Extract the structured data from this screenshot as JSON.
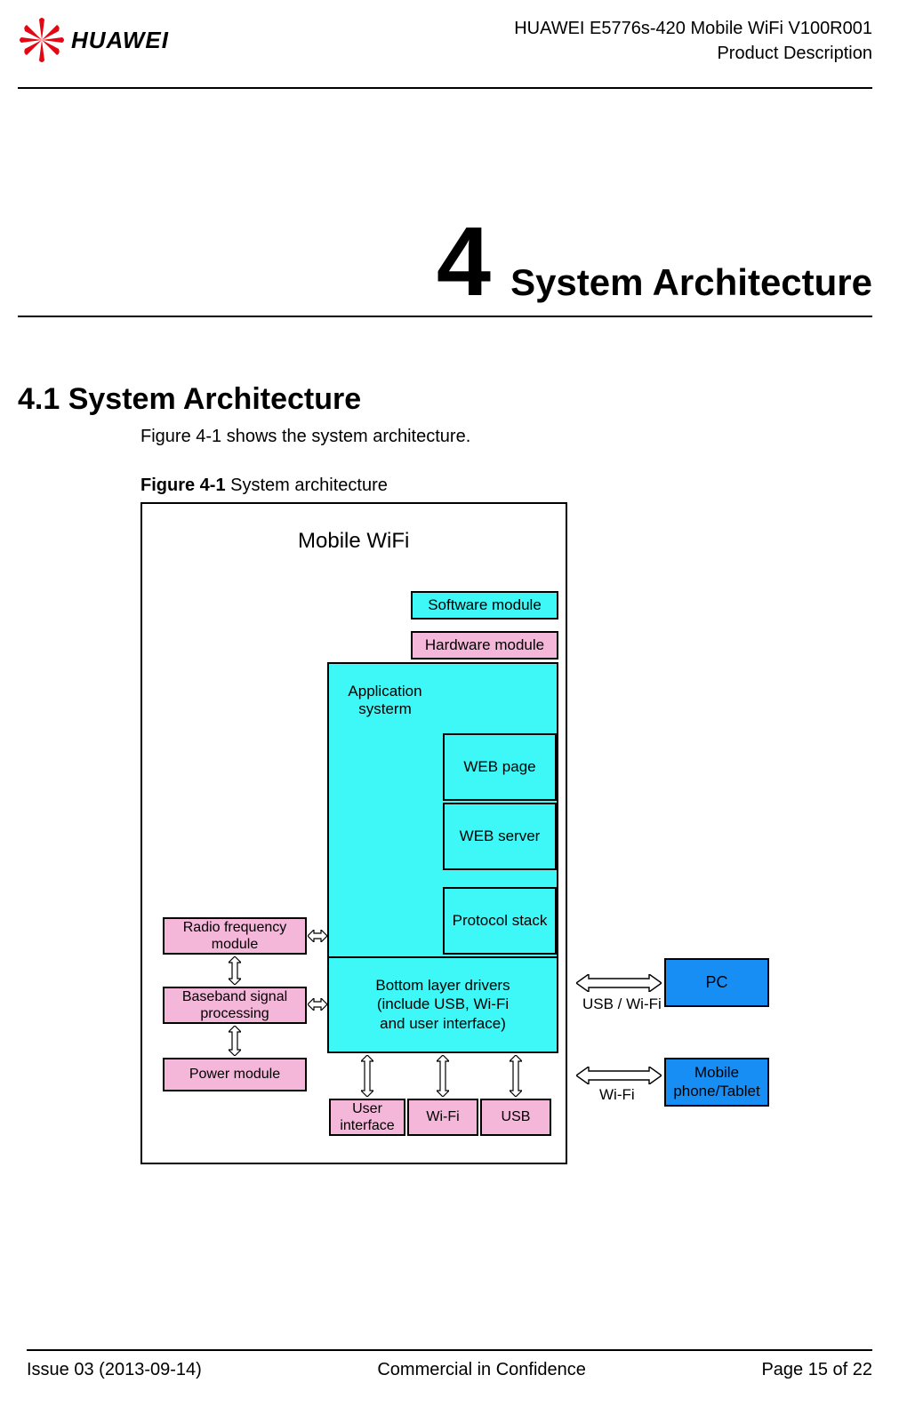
{
  "header": {
    "brand": "HUAWEI",
    "line1": "HUAWEI E5776s-420 Mobile WiFi V100R001",
    "line2": "Product Description"
  },
  "chapter": {
    "num": "4",
    "title": "System Architecture"
  },
  "section": {
    "heading": "4.1 System Architecture",
    "intro": "Figure 4-1 shows the system architecture."
  },
  "figure": {
    "label": "Figure 4-1",
    "caption": "System architecture"
  },
  "diagram": {
    "title": "Mobile WiFi",
    "legend": {
      "software": "Software module",
      "hardware": "Hardware module"
    },
    "app_layer": {
      "label": "Application\nsysterm",
      "web_page": "WEB page",
      "web_server": "WEB server",
      "protocol_stack": "Protocol stack",
      "bottom_drivers": "Bottom layer drivers\n(include USB, Wi-Fi\nand user interface)"
    },
    "hw_modules": {
      "rf": "Radio frequency\nmodule",
      "baseband": "Baseband signal\nprocessing",
      "power": "Power module",
      "ui": "User\ninterface",
      "wifi": "Wi-Fi",
      "usb": "USB"
    },
    "external": {
      "pc": "PC",
      "mobile": "Mobile\nphone/Tablet"
    },
    "links": {
      "usb_wifi": "USB / Wi-Fi",
      "wifi": "Wi-Fi"
    }
  },
  "footer": {
    "left": "Issue 03 (2013-09-14)",
    "center": "Commercial in Confidence",
    "right": "Page 15 of 22"
  }
}
